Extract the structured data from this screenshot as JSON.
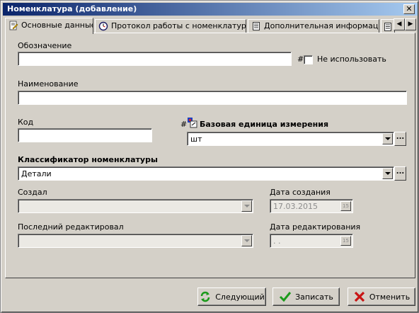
{
  "window": {
    "title": "Номенклатура (добавление)"
  },
  "tabs": [
    {
      "label": "Основные данные",
      "icon": "document-edit-icon"
    },
    {
      "label": "Протокол работы с номенклатурой",
      "icon": "clock-icon"
    },
    {
      "label": "Дополнительная информация",
      "icon": "document-icon"
    }
  ],
  "form": {
    "designation": {
      "label": "Обозначение",
      "value": ""
    },
    "not_used": {
      "prefix": "#",
      "label": "Не использовать",
      "checked": false
    },
    "name": {
      "label": "Наименование",
      "value": ""
    },
    "code": {
      "label": "Код",
      "value": ""
    },
    "base_unit": {
      "prefix": "#",
      "label": "Базовая единица измерения",
      "value": "шт",
      "ellipsis": "..."
    },
    "classifier": {
      "label": "Классификатор номенклатуры",
      "value": "Детали",
      "ellipsis": "..."
    },
    "created_by": {
      "label": "Создал",
      "value": ""
    },
    "created_date": {
      "label": "Дата создания",
      "value": "17.03.2015",
      "calendar_label": "15"
    },
    "last_editor": {
      "label": "Последний редактировал",
      "value": ""
    },
    "edited_date": {
      "label": "Дата редактирования",
      "value": ". .",
      "calendar_label": "15"
    }
  },
  "buttons": {
    "next": "Следующий",
    "save": "Записать",
    "cancel": "Отменить"
  },
  "colors": {
    "title_start": "#0a246a",
    "title_end": "#a6caf0",
    "face": "#d4d0c8",
    "check_green": "#1a9a1a",
    "cancel_red": "#c81414"
  }
}
